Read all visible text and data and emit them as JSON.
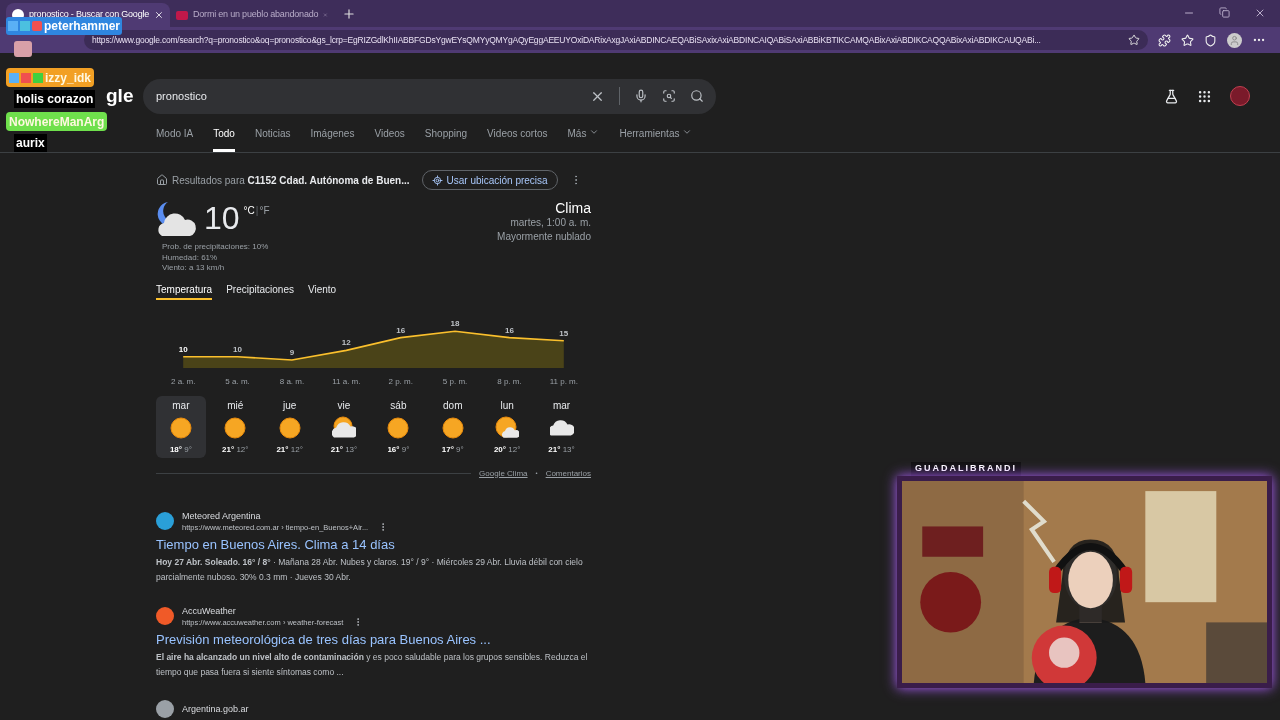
{
  "browser": {
    "tabs": [
      {
        "title": "pronostico - Buscar con Google",
        "selected": true
      },
      {
        "title": "Dormi en un pueblo abandonado",
        "selected": false
      }
    ],
    "url": "https://www.google.com/search?q=pronostico&oq=pronostico&gs_lcrp=EgRIZGdlKhIIABBFGDsYgwEYsQMYyQMYgAQyEggAEEUYOxiDARixAxgJAxiABDINCAEQABiSAxixAxiABDINCAIQABiSAxiABBiKBTIKCAMQABixAxiABDIKCAQQABixAxiABDIKCAUQABi..."
  },
  "google": {
    "logo_visible": "gle",
    "query": "pronostico",
    "nav": [
      {
        "label": "Modo IA",
        "selected": false
      },
      {
        "label": "Todo",
        "selected": true
      },
      {
        "label": "Noticias",
        "selected": false
      },
      {
        "label": "Imágenes",
        "selected": false
      },
      {
        "label": "Videos",
        "selected": false
      },
      {
        "label": "Shopping",
        "selected": false
      },
      {
        "label": "Videos cortos",
        "selected": false
      },
      {
        "label": "Más",
        "selected": false,
        "menu": true
      },
      {
        "label": "Herramientas",
        "selected": false,
        "menu": true
      }
    ]
  },
  "weather": {
    "location_prefix": "Resultados para",
    "location": "C1152 Cdad. Autónoma de Buen...",
    "precise_button": "Usar ubicación precisa",
    "temp": "10",
    "unit_c": "°C",
    "unit_sep": "|",
    "unit_f": "°F",
    "details": [
      "Prob. de precipitaciones: 10%",
      "Humedad: 61%",
      "Viento: a 13 km/h"
    ],
    "title": "Clima",
    "time": "martes, 1:00 a. m.",
    "condition": "Mayormente nublado",
    "tabs": [
      {
        "label": "Temperatura",
        "selected": true
      },
      {
        "label": "Precipitaciones",
        "selected": false
      },
      {
        "label": "Viento",
        "selected": false
      }
    ],
    "chart_data": {
      "type": "area",
      "categories": [
        "2 a. m.",
        "5 a. m.",
        "8 a. m.",
        "11 a. m.",
        "2 p. m.",
        "5 p. m.",
        "8 p. m.",
        "11 p. m."
      ],
      "series": [
        {
          "color": "#fbc02d",
          "values": [
            10,
            10,
            9,
            12,
            16,
            18,
            16,
            15
          ]
        }
      ],
      "data_labels": true
    },
    "days": [
      {
        "day": "mar",
        "kind": "sunny",
        "high": "18°",
        "low": "9°",
        "selected": true
      },
      {
        "day": "mié",
        "kind": "sunny",
        "high": "21°",
        "low": "12°",
        "selected": false
      },
      {
        "day": "jue",
        "kind": "sunny",
        "high": "21°",
        "low": "12°",
        "selected": false
      },
      {
        "day": "vie",
        "kind": "partly_cloudy",
        "high": "21°",
        "low": "13°",
        "selected": false
      },
      {
        "day": "sáb",
        "kind": "sunny",
        "high": "16°",
        "low": "9°",
        "selected": false
      },
      {
        "day": "dom",
        "kind": "sunny",
        "high": "17°",
        "low": "9°",
        "selected": false
      },
      {
        "day": "lun",
        "kind": "mostly_sunny",
        "high": "20°",
        "low": "12°",
        "selected": false
      },
      {
        "day": "mar",
        "kind": "cloudy",
        "high": "21°",
        "low": "13°",
        "selected": false
      }
    ],
    "footer_links": [
      "Google Clima",
      "Comentarios"
    ],
    "footer_sep": "•"
  },
  "results": [
    {
      "site": "Meteored Argentina",
      "url": "https://www.meteored.com.ar › tiempo-en_Buenos+Air...",
      "title": "Tiempo en Buenos Aires. Clima a 14 días",
      "snippet": "**Hoy 27 Abr. Soleado. 16° / 8°** · Mañana 28 Abr. Nubes y claros. 19° / 9° · Miércoles 29 Abr. Lluvia débil con cielo parcialmente nuboso. 30% 0.3 mm · Jueves 30 Abr.",
      "color": "#2a9fd8"
    },
    {
      "site": "AccuWeather",
      "url": "https://www.accuweather.com › weather-forecast",
      "title": "Previsión meteorológica de tres días para Buenos Aires ...",
      "snippet": "**El aire ha alcanzado un nivel alto de contaminación** y es poco saludable para los grupos sensibles. Reduzca el tiempo que pasa fuera si siente síntomas como ...",
      "color": "#f05a28"
    },
    {
      "site": "Argentina.gob.ar",
      "color": "#9aa0a6"
    }
  ],
  "stream": {
    "chat": [
      {
        "user": "peterhammer",
        "color": "#2f86e0"
      },
      {
        "user": "izzy_idk",
        "color": "#f2a024",
        "message": "holis corazon"
      },
      {
        "user": "NowhereManArg",
        "color": "#6fe04c",
        "message": "aurix"
      }
    ],
    "camera_label": "GUADALIBRANDI"
  }
}
